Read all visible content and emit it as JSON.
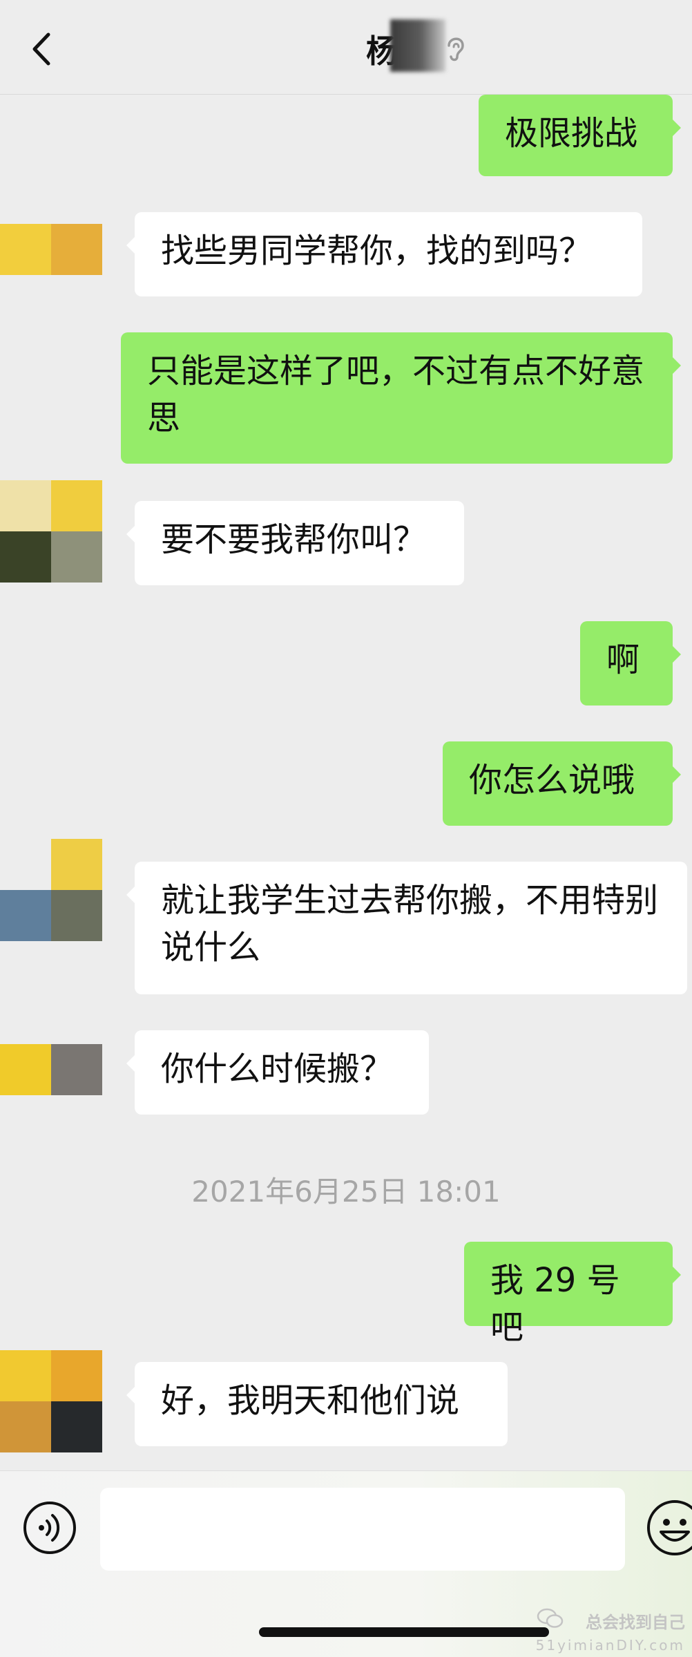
{
  "header": {
    "title": "杨",
    "back_icon": "chevron-left-icon",
    "status_icon": "ear-icon"
  },
  "messages": [
    {
      "side": "out",
      "text": "极限挑战"
    },
    {
      "side": "in",
      "text": "找些男同学帮你，找的到吗？"
    },
    {
      "side": "out",
      "text": "只能是这样了吧，不过有点不好意思"
    },
    {
      "side": "in",
      "text": "要不要我帮你叫？"
    },
    {
      "side": "out",
      "text": "啊"
    },
    {
      "side": "out",
      "text": "你怎么说哦"
    },
    {
      "side": "in",
      "text": "就让我学生过去帮你搬，不用特别说什么"
    },
    {
      "side": "in",
      "text": "你什么时候搬？"
    },
    {
      "side": "out",
      "text": "我 29 号吧"
    },
    {
      "side": "in",
      "text": "好，我明天和他们说"
    }
  ],
  "timestamp": "2021年6月25日 18:01",
  "input_bar": {
    "value": "",
    "voice_icon": "voice-icon",
    "emoji_icon": "emoji-icon"
  },
  "watermark": {
    "name": "总会找到自己",
    "site": "51yimianDIY.com"
  },
  "colors": {
    "background": "#ededed",
    "outgoing_bubble": "#95ec69",
    "incoming_bubble": "#ffffff",
    "timestamp": "#a6a6a6"
  }
}
